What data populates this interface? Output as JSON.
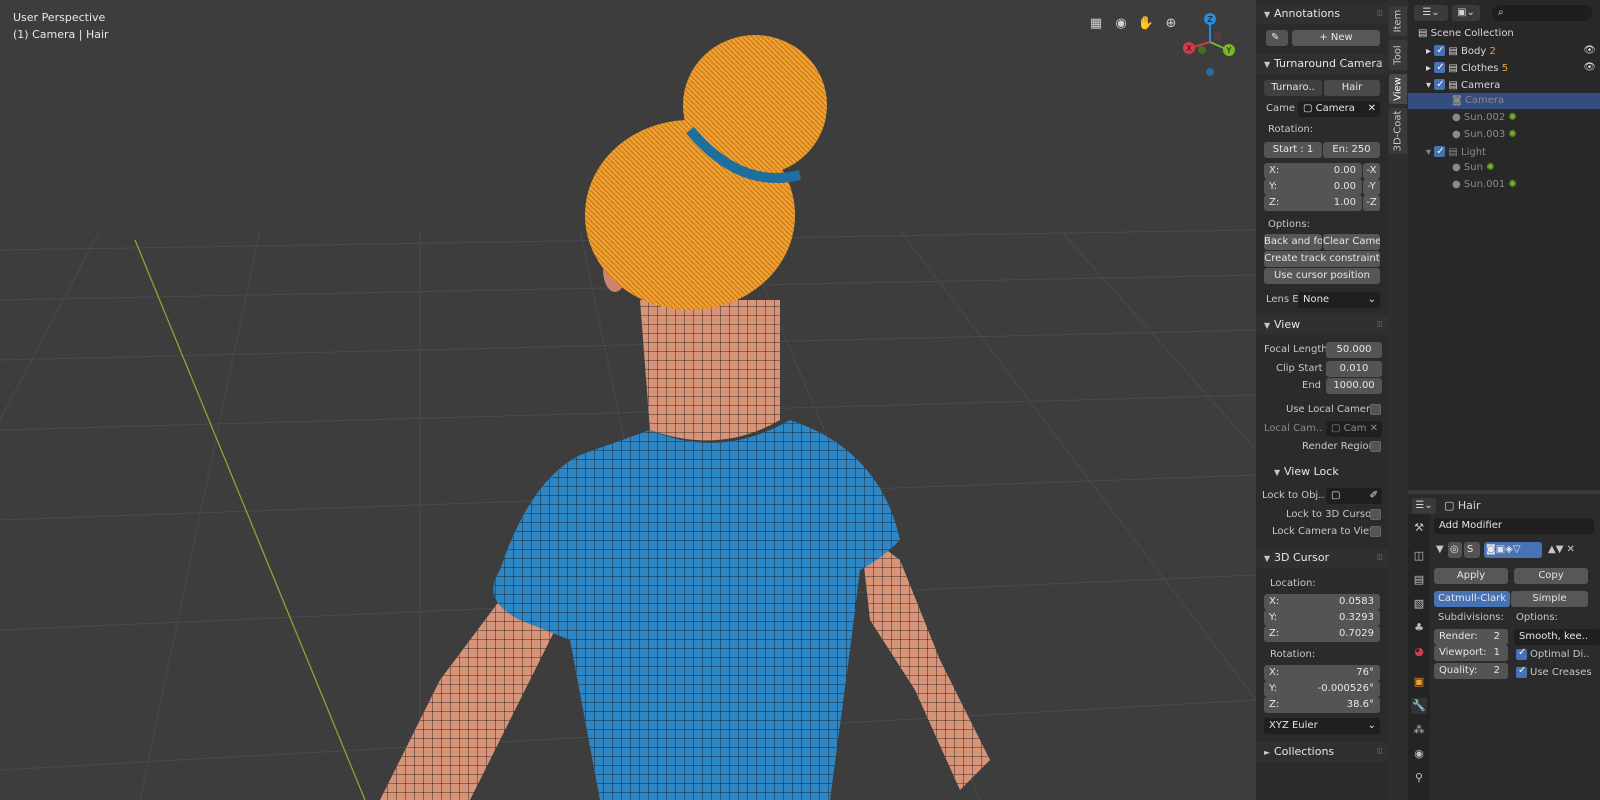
{
  "viewport": {
    "title": "User Perspective",
    "subtitle": "(1) Camera | Hair",
    "nav_icons": [
      "grid-icon",
      "camera-view-icon",
      "hand-pan-icon",
      "zoom-icon"
    ],
    "gizmo": {
      "z": "Z",
      "y": "Y",
      "x": "X"
    }
  },
  "sidebar_tabs": [
    "Item",
    "Tool",
    "View",
    "3D-Coat"
  ],
  "npanel": {
    "annotations": {
      "header": "Annotations",
      "new_label": "New"
    },
    "turnaround": {
      "header": "Turnaround Camera",
      "tab_turnaround": "Turnaro..",
      "tab_hair": "Hair",
      "camera_label": "Came",
      "camera_value": "Camera",
      "rotation_label": "Rotation:",
      "start": "Start : 1",
      "end": "En:  250",
      "x_label": "X:",
      "x_value": "0.00",
      "x_neg": "-X",
      "y_label": "Y:",
      "y_value": "0.00",
      "y_neg": "-Y",
      "z_label": "Z:",
      "z_value": "1.00",
      "z_neg": "-Z",
      "options_label": "Options:",
      "back_forth": "Back and fo..",
      "clear_camera": "Clear Camera",
      "create_track": "Create track constraint",
      "use_cursor": "Use cursor position",
      "lens_label": "Lens E",
      "lens_value": "None"
    },
    "view": {
      "header": "View",
      "focal_label": "Focal Length",
      "focal_value": "50.000",
      "clip_start_label": "Clip Start",
      "clip_start_value": "0.010",
      "end_label": "End",
      "end_value": "1000.00",
      "use_local_camera": "Use Local Camera",
      "local_cam_label": "Local Cam..",
      "local_cam_value": "Cam",
      "render_region": "Render Region"
    },
    "view_lock": {
      "header": "View Lock",
      "lock_obj_label": "Lock to Obj..",
      "lock_3d_cursor": "Lock to 3D Cursor",
      "lock_camera": "Lock Camera to View"
    },
    "cursor": {
      "header": "3D Cursor",
      "location_label": "Location:",
      "lx_label": "X:",
      "lx_value": "0.0583",
      "ly_label": "Y:",
      "ly_value": "0.3293",
      "lz_label": "Z:",
      "lz_value": "0.7029",
      "rotation_label": "Rotation:",
      "rx_label": "X:",
      "rx_value": "76°",
      "ry_label": "Y:",
      "ry_value": "-0.000526°",
      "rz_label": "Z:",
      "rz_value": "38.6°",
      "mode": "XYZ Euler"
    },
    "collections": {
      "header": "Collections"
    }
  },
  "outliner": {
    "root": "Scene Collection",
    "rows": [
      {
        "name": "Body",
        "badge": "2"
      },
      {
        "name": "Clothes",
        "badge": "5"
      },
      {
        "name": "Camera",
        "badge": ""
      },
      {
        "name": "Camera",
        "badge": ""
      },
      {
        "name": "Sun.002",
        "badge": ""
      },
      {
        "name": "Sun.003",
        "badge": ""
      },
      {
        "name": "Light",
        "badge": ""
      },
      {
        "name": "Sun",
        "badge": ""
      },
      {
        "name": "Sun.001",
        "badge": ""
      }
    ]
  },
  "properties": {
    "object_name": "Hair",
    "add_modifier": "Add Modifier",
    "modifier_short": "S",
    "apply": "Apply",
    "copy": "Copy",
    "catmull": "Catmull-Clark",
    "simple": "Simple",
    "subdivisions_label": "Subdivisions:",
    "options_label": "Options:",
    "render_label": "Render:",
    "render_value": "2",
    "viewport_label": "Viewport:",
    "viewport_value": "1",
    "quality_label": "Quality:",
    "quality_value": "2",
    "smooth": "Smooth, kee..",
    "optimal": "Optimal Di..",
    "use_creases": "Use Creases"
  },
  "colors": {
    "accent": "#4772b3",
    "hair": "#f0a030",
    "clothes": "#2f86c4",
    "skin": "#d89478"
  }
}
